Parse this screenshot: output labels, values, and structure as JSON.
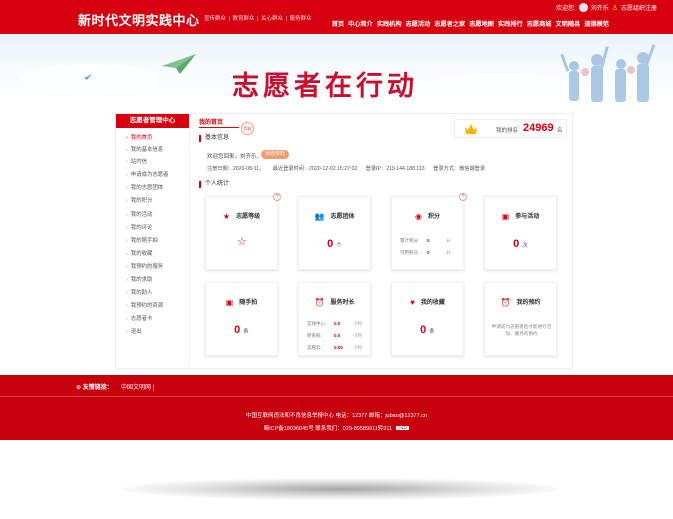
{
  "header": {
    "title": "新时代文明实践中心",
    "top_links": [
      "宣传群众",
      "|",
      "教育群众",
      "|",
      "关心群众",
      "|",
      "服务群众"
    ],
    "welcome": "欢迎您:",
    "username": "刘齐乐",
    "org_register": "志愿组织注册",
    "nav": [
      "首页",
      "中心简介",
      "实践机构",
      "志愿活动",
      "志愿者之家",
      "志愿地图",
      "实践排行",
      "志愿商城",
      "文明随县",
      "道德模范"
    ]
  },
  "banner": {
    "title": "志愿者在行动"
  },
  "sidebar": {
    "title": "志愿者管理中心",
    "items": [
      "我的首页",
      "我的基本信息",
      "站内信",
      "申请成为志愿者",
      "我的志愿团体",
      "我的积分",
      "我的活动",
      "我的评论",
      "我的随手拍",
      "我的收藏",
      "我预约的服务",
      "我的求助",
      "我的助人",
      "我预约的资源",
      "志愿者卡",
      "退出"
    ]
  },
  "main": {
    "breadcrumb": "我的首页",
    "level_badge": "等级",
    "rank": {
      "label": "我的排名",
      "value": "24969",
      "unit": "名"
    },
    "basic_title": "基本信息",
    "welcome_text": "欢迎您回来，刘齐乐，",
    "edit_button": "修改资料",
    "info": {
      "register": "注册日期：2020-08-11。",
      "last_login": "最近登录时间：2020-12-02 15:27:02",
      "ip": "登录IP：219.144.188.113",
      "method": "登录方式：微信端登录"
    },
    "stats_title": "个人统计",
    "cards": {
      "level": {
        "title": "志愿等级"
      },
      "team": {
        "title": "志愿团体",
        "value": "0",
        "unit": "个"
      },
      "points": {
        "title": "积分",
        "rows": [
          {
            "label": "累计积分:",
            "value": "0",
            "unit": "分"
          },
          {
            "label": "可用积分:",
            "value": "0",
            "unit": "分"
          }
        ]
      },
      "activity": {
        "title": "参与活动",
        "value": "0",
        "unit": "次"
      },
      "photo": {
        "title": "随手拍",
        "value": "0",
        "unit": "条"
      },
      "hours": {
        "title": "服务时长",
        "rows": [
          {
            "label": "实践中心:",
            "value": "0.0",
            "unit": "小时"
          },
          {
            "label": "原系统:",
            "value": "0.0",
            "unit": "小时"
          },
          {
            "label": "志愿云:",
            "value": "0.00",
            "unit": "小时"
          }
        ]
      },
      "favorites": {
        "title": "我的收藏",
        "value": "0",
        "unit": "条"
      },
      "reservation": {
        "title": "我的预约",
        "desc": "申请成为志愿者后才能进行活动、服务的预约"
      }
    }
  },
  "footer": {
    "friend_label": "友情链接：",
    "friend_link": "中国文明网 |",
    "line1": "中国互联网违法和不良信息举报中心   电话：12377   邮箱：jubao@12377.cn",
    "line2": "蜀ICP备18036045号     联系我们：029-89589911转911",
    "cnzz": "CNZZ"
  },
  "colors": {
    "brand_red": "#d7000f",
    "accent_orange": "#f59a6a",
    "footer_red": "#c8000e"
  }
}
